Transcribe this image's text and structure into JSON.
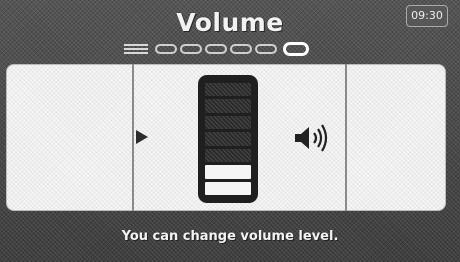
{
  "header": {
    "title": "Volume",
    "clock": "09:30"
  },
  "page_indicator": {
    "total_dots": 6,
    "current_index": 6
  },
  "volume": {
    "levels_total": 7,
    "levels_filled": 2
  },
  "icons": {
    "left_arrow": "arrow-left-icon",
    "speaker": "speaker-volume-icon"
  },
  "status": {
    "message": "You can change volume level."
  }
}
